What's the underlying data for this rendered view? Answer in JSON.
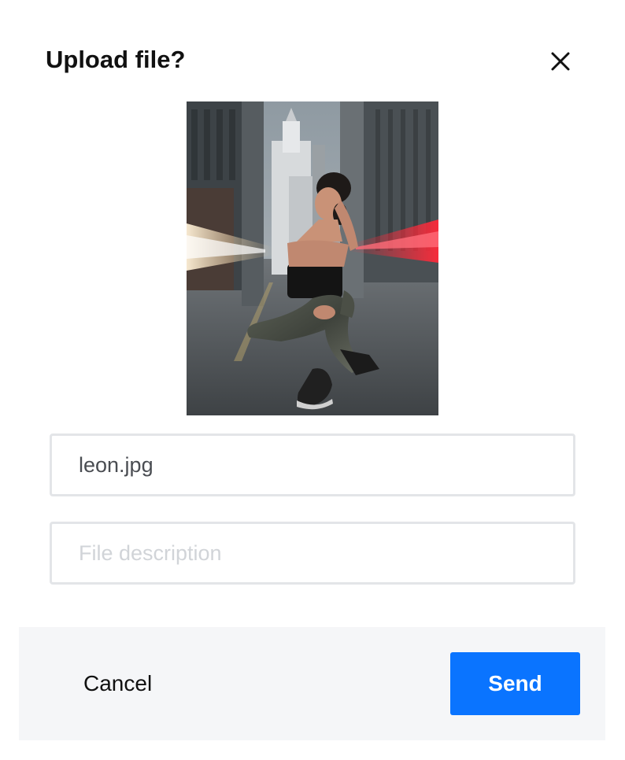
{
  "dialog": {
    "title": "Upload file?",
    "close_icon": "close-icon"
  },
  "preview": {
    "image_alt": "street-photo-preview"
  },
  "file_name": {
    "value": "leon.jpg"
  },
  "file_description": {
    "placeholder": "File description",
    "value": ""
  },
  "footer": {
    "cancel_label": "Cancel",
    "send_label": "Send"
  },
  "colors": {
    "primary": "#0a74ff",
    "field_border": "#e3e5e8",
    "footer_bg": "#f5f6f8"
  }
}
